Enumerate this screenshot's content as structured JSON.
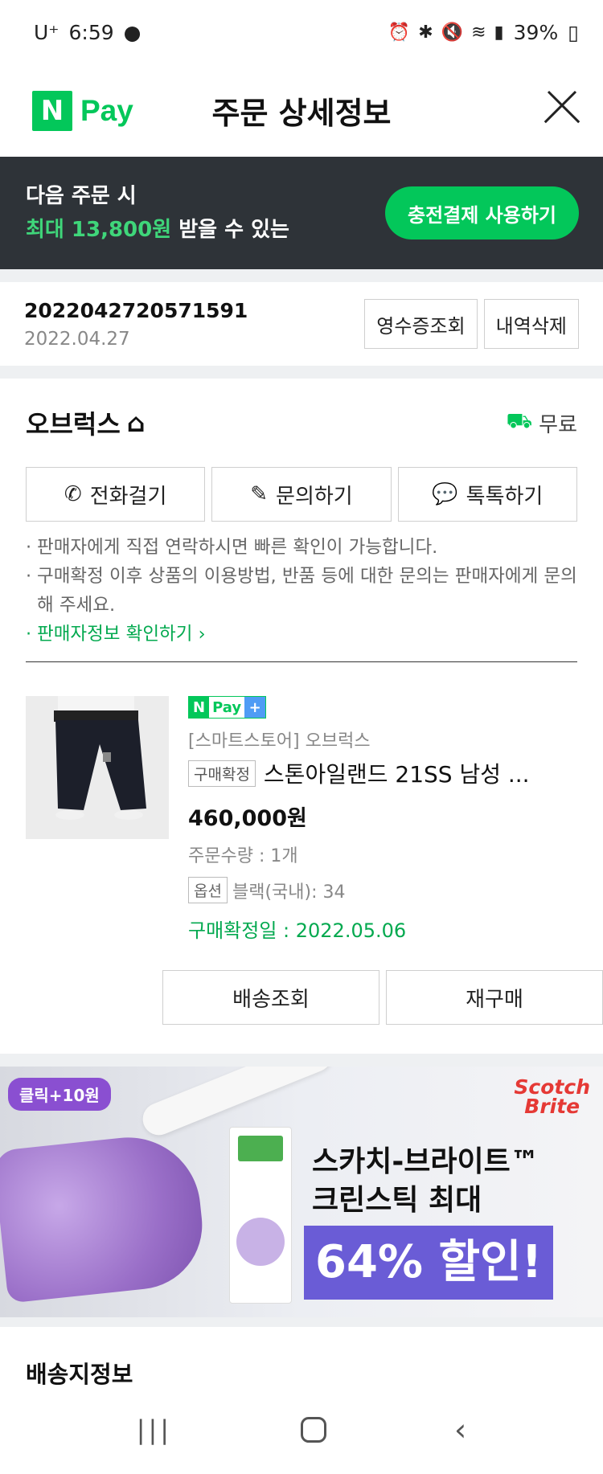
{
  "status_bar": {
    "carrier": "U⁺",
    "time": "6:59",
    "battery": "39%"
  },
  "header": {
    "logo_n": "N",
    "logo_pay": "Pay",
    "title": "주문 상세정보"
  },
  "promo": {
    "line1": "다음 주문 시",
    "highlight": "최대 13,800원",
    "line2_rest": " 받을 수 있는",
    "button_label": "충전결제 사용하기"
  },
  "order": {
    "number": "2022042720571591",
    "date": "2022.04.27",
    "receipt_label": "영수증조회",
    "delete_label": "내역삭제"
  },
  "seller": {
    "name": "오브럭스",
    "shipping": "무료",
    "call_label": "전화걸기",
    "inquiry_label": "문의하기",
    "talk_label": "톡톡하기",
    "notes": [
      "판매자에게 직접 연락하시면 빠른 확인이 가능합니다.",
      "구매확정 이후 상품의 이용방법, 반품 등에 대한 문의는 판매자에게 문의해 주세요."
    ],
    "seller_info_link": "판매자정보 확인하기"
  },
  "product": {
    "badge_n": "N",
    "badge_pay": "Pay",
    "badge_plus": "+",
    "store": "[스마트스토어] 오브럭스",
    "status": "구매확정",
    "title": "스톤아일랜드 21SS 남성 ...",
    "price": "460,000원",
    "quantity": "주문수량 : 1개",
    "option_tag": "옵션",
    "option_value": "블랙(국내): 34",
    "confirm_date": "구매확정일 : 2022.05.06",
    "shipping_track_label": "배송조회",
    "rebuy_label": "재구매"
  },
  "ad": {
    "badge": "클릭+10원",
    "brand_line1": "Scotch",
    "brand_line2": "Brite",
    "headline_line1": "스카치-브라이트™",
    "headline_line2": "크린스틱 최대",
    "discount": "64% 할인!"
  },
  "delivery_section": {
    "title": "배송지정보"
  },
  "nav": {
    "recent": "|||",
    "back": "‹"
  }
}
